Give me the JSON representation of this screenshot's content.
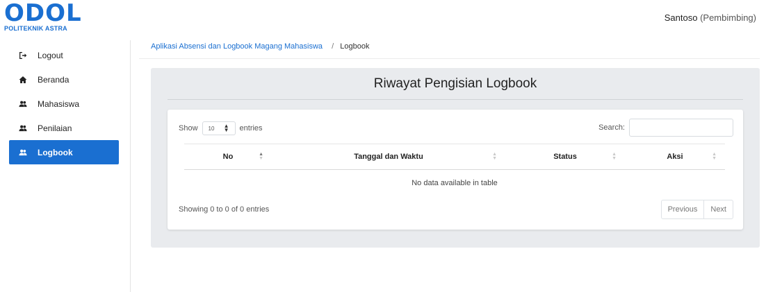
{
  "brand": {
    "name": "ODOL",
    "subtitle": "POLITEKNIK ASTRA"
  },
  "user": {
    "name": "Santoso",
    "role": "(Pembimbing)"
  },
  "sidebar": {
    "items": [
      {
        "label": "Logout",
        "icon": "logout-icon"
      },
      {
        "label": "Beranda",
        "icon": "home-icon"
      },
      {
        "label": "Mahasiswa",
        "icon": "users-icon"
      },
      {
        "label": "Penilaian",
        "icon": "users-icon"
      },
      {
        "label": "Logbook",
        "icon": "users-icon",
        "active": true
      }
    ]
  },
  "breadcrumb": {
    "home": "Aplikasi Absensi dan Logbook Magang Mahasiswa",
    "separator": "/",
    "current": "Logbook"
  },
  "panel": {
    "title": "Riwayat Pengisian Logbook"
  },
  "table": {
    "length_prefix": "Show",
    "length_value": "10",
    "length_suffix": "entries",
    "search_label": "Search:",
    "search_value": "",
    "columns": [
      "No",
      "Tanggal dan Waktu",
      "Status",
      "Aksi"
    ],
    "empty_message": "No data available in table",
    "info": "Showing 0 to 0 of 0 entries",
    "prev": "Previous",
    "next": "Next"
  },
  "colors": {
    "primary": "#1a6fd1",
    "panel_bg": "#e9ebee"
  }
}
